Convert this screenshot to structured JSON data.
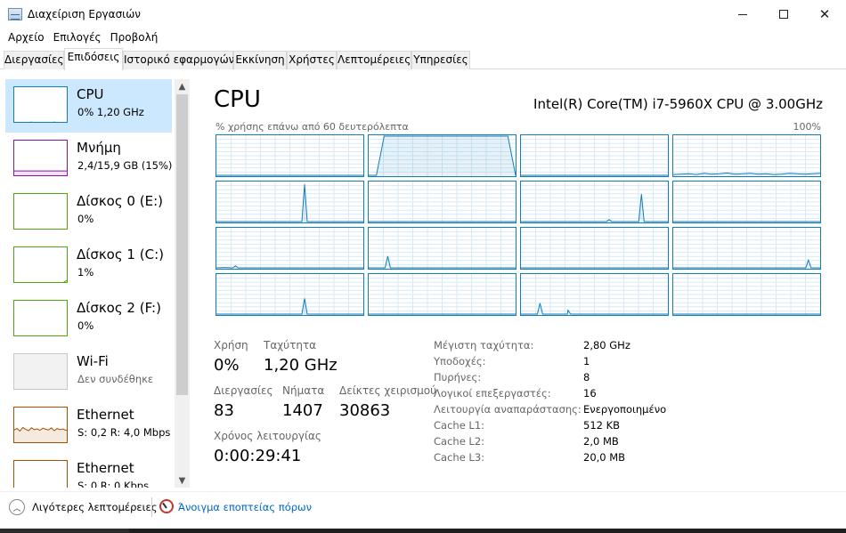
{
  "window": {
    "title": "Διαχείριση Εργασιών"
  },
  "menu": [
    "Αρχείο",
    "Επιλογές",
    "Προβολή"
  ],
  "tabs": [
    {
      "label": "Διεργασίες"
    },
    {
      "label": "Επιδόσεις",
      "active": true
    },
    {
      "label": "Ιστορικό εφαρμογών"
    },
    {
      "label": "Εκκίνηση"
    },
    {
      "label": "Χρήστες"
    },
    {
      "label": "Λεπτομέρειες"
    },
    {
      "label": "Υπηρεσίες"
    }
  ],
  "resources": [
    {
      "name": "CPU",
      "detail": "0% 1,20 GHz",
      "color": "#117dbb",
      "selected": true,
      "usage": [
        1,
        1,
        1,
        1,
        1,
        1,
        2,
        1,
        1,
        1,
        1,
        1,
        1,
        1,
        2,
        1,
        1,
        1,
        1,
        1
      ]
    },
    {
      "name": "Μνήμη",
      "detail": "2,4/15,9 GB (15%)",
      "color": "#8b12ae",
      "usage": [
        15,
        15,
        15,
        15,
        15,
        15,
        15,
        15,
        15,
        15,
        15,
        15,
        15,
        15,
        15,
        15,
        15,
        15,
        15,
        15
      ]
    },
    {
      "name": "Δίσκος 0 (E:)",
      "detail": "0%",
      "color": "#4da60c",
      "usage": [
        0,
        0,
        0,
        0,
        0,
        0,
        0,
        0,
        0,
        0,
        0,
        0,
        0,
        0,
        0,
        0,
        0,
        0,
        0,
        0
      ]
    },
    {
      "name": "Δίσκος 1 (C:)",
      "detail": "1%",
      "color": "#4da60c",
      "usage": [
        0,
        0,
        0,
        0,
        0,
        0,
        0,
        0,
        0,
        0,
        0,
        0,
        0,
        0,
        0,
        0,
        0,
        0,
        6,
        8
      ]
    },
    {
      "name": "Δίσκος 2 (F:)",
      "detail": "0%",
      "color": "#4da60c",
      "usage": [
        0,
        0,
        0,
        0,
        0,
        0,
        0,
        0,
        0,
        0,
        0,
        0,
        0,
        0,
        0,
        0,
        0,
        0,
        0,
        0
      ]
    },
    {
      "name": "Wi-Fi",
      "detail": "Δεν συνδέθηκε",
      "color": "#a0a0a0",
      "muted": true,
      "usage": []
    },
    {
      "name": "Ethernet",
      "detail": "S: 0,2 R: 4,0 Mbps",
      "color": "#a74f01",
      "usage": [
        38,
        42,
        35,
        45,
        40,
        36,
        44,
        39,
        41,
        37,
        43,
        40,
        38,
        44,
        36,
        42,
        39,
        41,
        37,
        40
      ]
    },
    {
      "name": "Ethernet",
      "detail": "S: 0 R: 0 Kbps",
      "color": "#a74f01",
      "usage": []
    }
  ],
  "cpu": {
    "heading": "CPU",
    "model": "Intel(R) Core(TM) i7-5960X CPU @ 3.00GHz",
    "graph_caption": "% χρήσης επάνω από 60 δευτερόλεπτα",
    "graph_max": "100%",
    "cores": [
      [
        0,
        0,
        0,
        0,
        0,
        0,
        0,
        0,
        0,
        0,
        0,
        0,
        0,
        0,
        0,
        0,
        0,
        0,
        0,
        0
      ],
      [
        0,
        0,
        100,
        100,
        100,
        100,
        100,
        100,
        100,
        100,
        100,
        100,
        100,
        100,
        100,
        100,
        100,
        100,
        100,
        0
      ],
      [
        0,
        0,
        0,
        0,
        0,
        0,
        0,
        0,
        0,
        0,
        0,
        0,
        0,
        0,
        0,
        0,
        0,
        0,
        0,
        0
      ],
      [
        2,
        3,
        4,
        2,
        5,
        3,
        4,
        6,
        3,
        4,
        5,
        3,
        4,
        2,
        3,
        5,
        4,
        3,
        4,
        5
      ],
      [
        0,
        0,
        0,
        0,
        0,
        0,
        0,
        0,
        0,
        0,
        0,
        0,
        0,
        0,
        0,
        0,
        0,
        0,
        0,
        0
      ],
      [
        0,
        0,
        0,
        0,
        0,
        0,
        0,
        0,
        0,
        0,
        0,
        0,
        0,
        0,
        0,
        0,
        0,
        0,
        0,
        0
      ],
      [
        0,
        0,
        0,
        0,
        0,
        0,
        0,
        0,
        0,
        0,
        0,
        0,
        0,
        0,
        0,
        0,
        0,
        0,
        0,
        0
      ],
      [
        0,
        0,
        0,
        0,
        0,
        0,
        0,
        0,
        0,
        0,
        0,
        0,
        0,
        0,
        0,
        0,
        0,
        0,
        0,
        0
      ],
      [
        0,
        1,
        0,
        0,
        0,
        0,
        0,
        0,
        0,
        0,
        0,
        0,
        0,
        0,
        0,
        0,
        0,
        0,
        0,
        0
      ],
      [
        0,
        0,
        0,
        0,
        0,
        0,
        0,
        0,
        0,
        0,
        0,
        0,
        0,
        0,
        0,
        0,
        0,
        0,
        0,
        0
      ],
      [
        0,
        0,
        0,
        0,
        0,
        0,
        0,
        0,
        0,
        0,
        0,
        0,
        0,
        0,
        0,
        0,
        0,
        0,
        0,
        0
      ],
      [
        0,
        0,
        0,
        0,
        0,
        0,
        0,
        0,
        0,
        0,
        0,
        0,
        0,
        0,
        0,
        0,
        0,
        0,
        0,
        0
      ],
      [
        0,
        0,
        0,
        0,
        0,
        0,
        0,
        0,
        0,
        0,
        0,
        0,
        0,
        0,
        0,
        0,
        0,
        0,
        0,
        0
      ],
      [
        0,
        0,
        0,
        0,
        0,
        0,
        0,
        0,
        0,
        0,
        0,
        0,
        0,
        0,
        0,
        0,
        0,
        0,
        0,
        0
      ],
      [
        0,
        0,
        0,
        0,
        0,
        0,
        0,
        0,
        0,
        0,
        0,
        0,
        0,
        0,
        0,
        0,
        0,
        0,
        0,
        0
      ],
      [
        0,
        0,
        0,
        0,
        0,
        0,
        0,
        0,
        0,
        0,
        0,
        0,
        0,
        0,
        0,
        0,
        0,
        0,
        0,
        0
      ]
    ],
    "spikes": [
      [],
      [],
      [],
      [],
      [
        {
          "at": 0.6,
          "h": 95
        }
      ],
      [],
      [
        {
          "at": 0.6,
          "h": 5
        },
        {
          "at": 0.82,
          "h": 70
        }
      ],
      [],
      [
        {
          "at": 0.13,
          "h": 5
        }
      ],
      [
        {
          "at": 0.13,
          "h": 30
        }
      ],
      [],
      [
        {
          "at": 0.92,
          "h": 20
        }
      ],
      [
        {
          "at": 0.6,
          "h": 40
        }
      ],
      [],
      [
        {
          "at": 0.13,
          "h": 28
        },
        {
          "at": 0.32,
          "h": 10
        }
      ],
      []
    ],
    "stats": {
      "utilization_label": "Χρήση",
      "utilization": "0%",
      "speed_label": "Ταχύτητα",
      "speed": "1,20 GHz",
      "processes_label": "Διεργασίες",
      "processes": "83",
      "threads_label": "Νήματα",
      "threads": "1407",
      "handles_label": "Δείκτες χειρισμού",
      "handles": "30863",
      "uptime_label": "Χρόνος λειτουργίας",
      "uptime": "0:00:29:41"
    },
    "specs": [
      {
        "label": "Μέγιστη ταχύτητα:",
        "value": "2,80 GHz"
      },
      {
        "label": "Υποδοχές:",
        "value": "1"
      },
      {
        "label": "Πυρήνες:",
        "value": "8"
      },
      {
        "label": "Λογικοί επεξεργαστές:",
        "value": "16"
      },
      {
        "label": "Λειτουργία αναπαράστασης:",
        "value": "Ενεργοποιημένο"
      },
      {
        "label": "Cache L1:",
        "value": "512 KB"
      },
      {
        "label": "Cache L2:",
        "value": "2,0 MB"
      },
      {
        "label": "Cache L3:",
        "value": "20,0 MB"
      }
    ]
  },
  "footer": {
    "fewer_details": "Λιγότερες λεπτομέρειες",
    "resource_monitor": "Άνοιγμα εποπτείας πόρων"
  }
}
